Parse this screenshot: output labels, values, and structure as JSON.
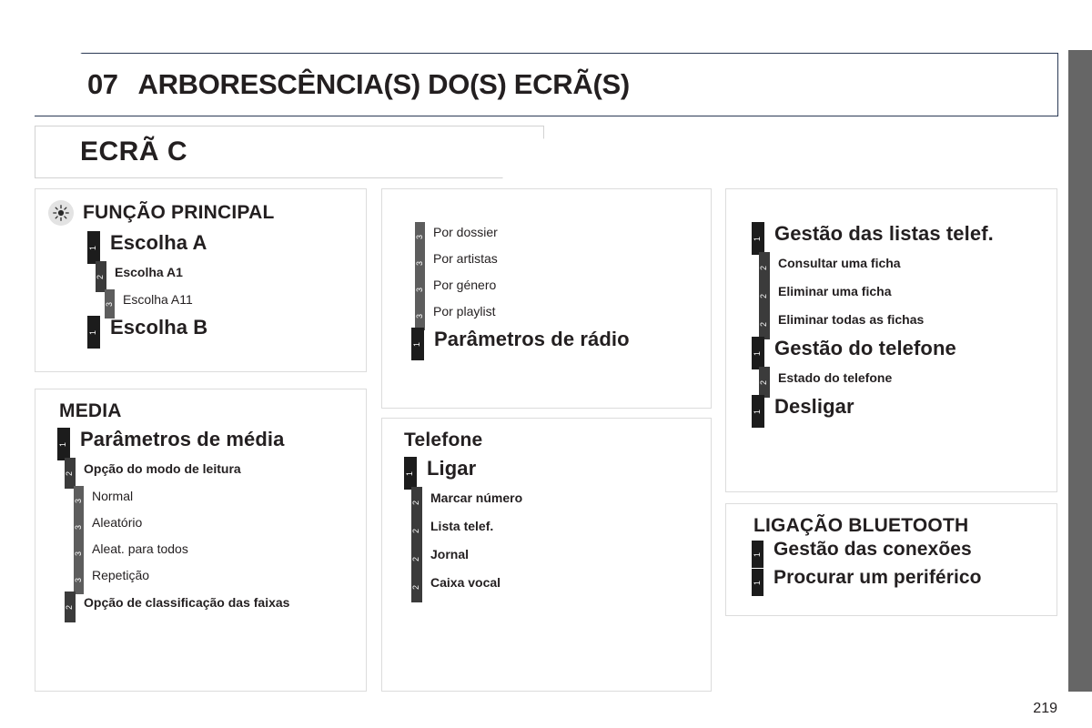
{
  "page": {
    "number": "219",
    "edge_tab_color": "#666666",
    "banner_border_color": "#2b3a55"
  },
  "chapter": {
    "number": "07",
    "title": "ARBORESCÊNCIA(S) DO(S) ECRÃ(S)"
  },
  "screen_banner": {
    "label": "ECRÃ C"
  },
  "legend": {
    "level1_color": "#1c1c1c",
    "level2_color": "#3b3b3b",
    "level3_color": "#5d5d5d",
    "level1": "1",
    "level2": "2",
    "level3": "3"
  },
  "boxes": {
    "funcao_principal": {
      "heading": "FUNÇÃO PRINCIPAL",
      "icon": "sun-icon",
      "entries": [
        {
          "level": 1,
          "label": "Escolha A"
        },
        {
          "level": 2,
          "label": "Escolha A1"
        },
        {
          "level": 3,
          "label": "Escolha A11"
        },
        {
          "level": 1,
          "label": "Escolha B"
        }
      ]
    },
    "media": {
      "heading": "MEDIA",
      "entries": [
        {
          "level": 1,
          "label": "Parâmetros de média"
        },
        {
          "level": 2,
          "label": "Opção do modo de leitura"
        },
        {
          "level": 3,
          "label": "Normal"
        },
        {
          "level": 3,
          "label": "Aleatório"
        },
        {
          "level": 3,
          "label": "Aleat. para todos"
        },
        {
          "level": 3,
          "label": "Repetição"
        },
        {
          "level": 2,
          "label": "Opção de classificação das faixas"
        }
      ]
    },
    "radio": {
      "heading": "",
      "entries": [
        {
          "level": 3,
          "label": "Por dossier"
        },
        {
          "level": 3,
          "label": "Por artistas"
        },
        {
          "level": 3,
          "label": "Por género"
        },
        {
          "level": 3,
          "label": "Por playlist"
        },
        {
          "level": 1,
          "label": "Parâmetros de rádio"
        }
      ]
    },
    "telefone": {
      "heading": "Telefone",
      "entries": [
        {
          "level": 1,
          "label": "Ligar"
        },
        {
          "level": 2,
          "label": "Marcar número"
        },
        {
          "level": 2,
          "label": "Lista telef."
        },
        {
          "level": 2,
          "label": "Jornal"
        },
        {
          "level": 2,
          "label": "Caixa vocal"
        }
      ]
    },
    "listas": {
      "heading": "",
      "entries": [
        {
          "level": 1,
          "label": "Gestão das listas telef."
        },
        {
          "level": 2,
          "label": "Consultar uma ficha"
        },
        {
          "level": 2,
          "label": "Eliminar uma ficha"
        },
        {
          "level": 2,
          "label": "Eliminar todas as fichas"
        },
        {
          "level": 1,
          "label": "Gestão do telefone"
        },
        {
          "level": 2,
          "label": "Estado do telefone"
        },
        {
          "level": 1,
          "label": "Desligar"
        }
      ]
    },
    "bluetooth": {
      "heading": "LIGAÇÃO BLUETOOTH",
      "entries": [
        {
          "level": 1,
          "label": "Gestão das conexões"
        },
        {
          "level": 1,
          "label": "Procurar um periférico"
        }
      ]
    }
  }
}
